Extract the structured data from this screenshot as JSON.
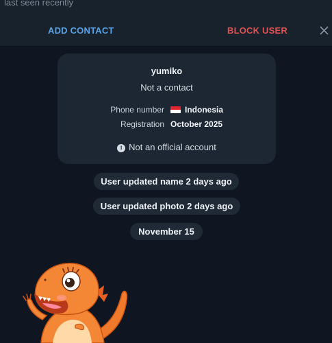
{
  "header": {
    "last_seen": "last seen recently",
    "add_contact_label": "ADD CONTACT",
    "block_user_label": "BLOCK USER"
  },
  "profile_card": {
    "name": "yumiko",
    "status": "Not a contact",
    "rows": [
      {
        "label": "Phone number",
        "value": "Indonesia",
        "flag": "indonesia-flag"
      },
      {
        "label": "Registration",
        "value": "October 2025"
      }
    ],
    "official_note": "Not an official account",
    "official_icon": "info-icon"
  },
  "service_messages": [
    "User updated name 2 days ago",
    "User updated photo 2 days ago"
  ],
  "date_separator": "November 15",
  "sticker": {
    "name": "orange-dinosaur-sticker"
  },
  "colors": {
    "background": "#0f1621",
    "topbar": "#18222d",
    "card": "#1c2733",
    "accent_blue": "#5aa2e6",
    "danger_red": "#e0524f"
  }
}
